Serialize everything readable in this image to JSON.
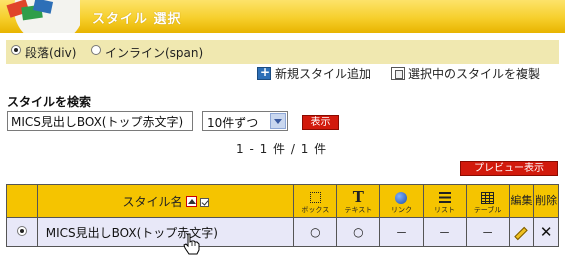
{
  "header": {
    "title": "スタイル 選択"
  },
  "mode": {
    "options": [
      {
        "label": "段落(div)",
        "selected": true
      },
      {
        "label": "インライン(span)",
        "selected": false
      }
    ]
  },
  "actions": {
    "add_style": "新規スタイル追加",
    "copy_style": "選択中のスタイルを複製"
  },
  "search": {
    "title": "スタイルを検索",
    "value": "MICS見出しBOX(トップ赤文字)",
    "per_page": "10件ずつ",
    "button": "表示",
    "count": "1 - 1 件 / 1 件"
  },
  "preview_button": "プレビュー表示",
  "table": {
    "name_header": "スタイル名",
    "columns": [
      {
        "label": "ボックス",
        "icon": "box-icon"
      },
      {
        "label": "テキスト",
        "icon": "text-icon"
      },
      {
        "label": "リンク",
        "icon": "link-icon"
      },
      {
        "label": "リスト",
        "icon": "list-icon"
      },
      {
        "label": "テーブル",
        "icon": "table-icon"
      }
    ],
    "edit_header": "編集",
    "delete_header": "削除",
    "rows": [
      {
        "name": "MICS見出しBOX(トップ赤文字)",
        "box": "○",
        "text": "○",
        "link": "－",
        "list": "－",
        "table": "－"
      }
    ]
  },
  "colors": {
    "header": "#f6cf2c",
    "accent_red": "#d21a0c",
    "row_bg": "#e8e8f8",
    "table_header": "#f5c400"
  }
}
